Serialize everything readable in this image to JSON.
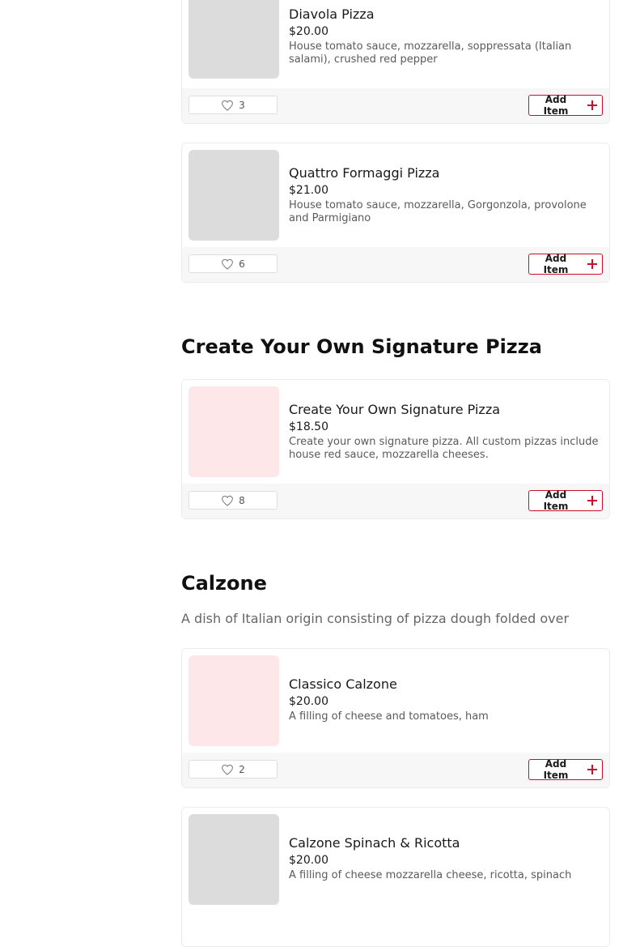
{
  "items": [
    {
      "name": "Diavola Pizza",
      "price": "$20.00",
      "description": "House tomato sauce, mozzarella, soppressata (Italian salami), crushed red pepper",
      "likes": "3",
      "add_label": "Add Item"
    },
    {
      "name": "Quattro Formaggi Pizza",
      "price": "$21.00",
      "description": "House tomato sauce, mozzarella, Gorgonzola, provolone and Parmigiano",
      "likes": "6",
      "add_label": "Add Item"
    },
    {
      "name": "Create Your Own Signature Pizza",
      "price": "$18.50",
      "description": "Create your own signature pizza. All custom pizzas include house red sauce, mozzarella cheeses.",
      "likes": "8",
      "add_label": "Add Item"
    },
    {
      "name": "Classico Calzone",
      "price": "$20.00",
      "description": "A filling of cheese and tomatoes, ham",
      "likes": "2",
      "add_label": "Add Item"
    },
    {
      "name": "Calzone Spinach & Ricotta",
      "price": "$20.00",
      "description": "A filling of cheese mozzarella cheese, ricotta, spinach"
    }
  ],
  "sections": {
    "signature": {
      "title": "Create Your Own Signature Pizza"
    },
    "calzone": {
      "title": "Calzone",
      "description": "A dish of Italian origin consisting of pizza dough folded over"
    }
  },
  "colors": {
    "accent": "#c8102e",
    "placeholder_grey": "#dcdcdc",
    "placeholder_pink": "#fde7e9"
  }
}
